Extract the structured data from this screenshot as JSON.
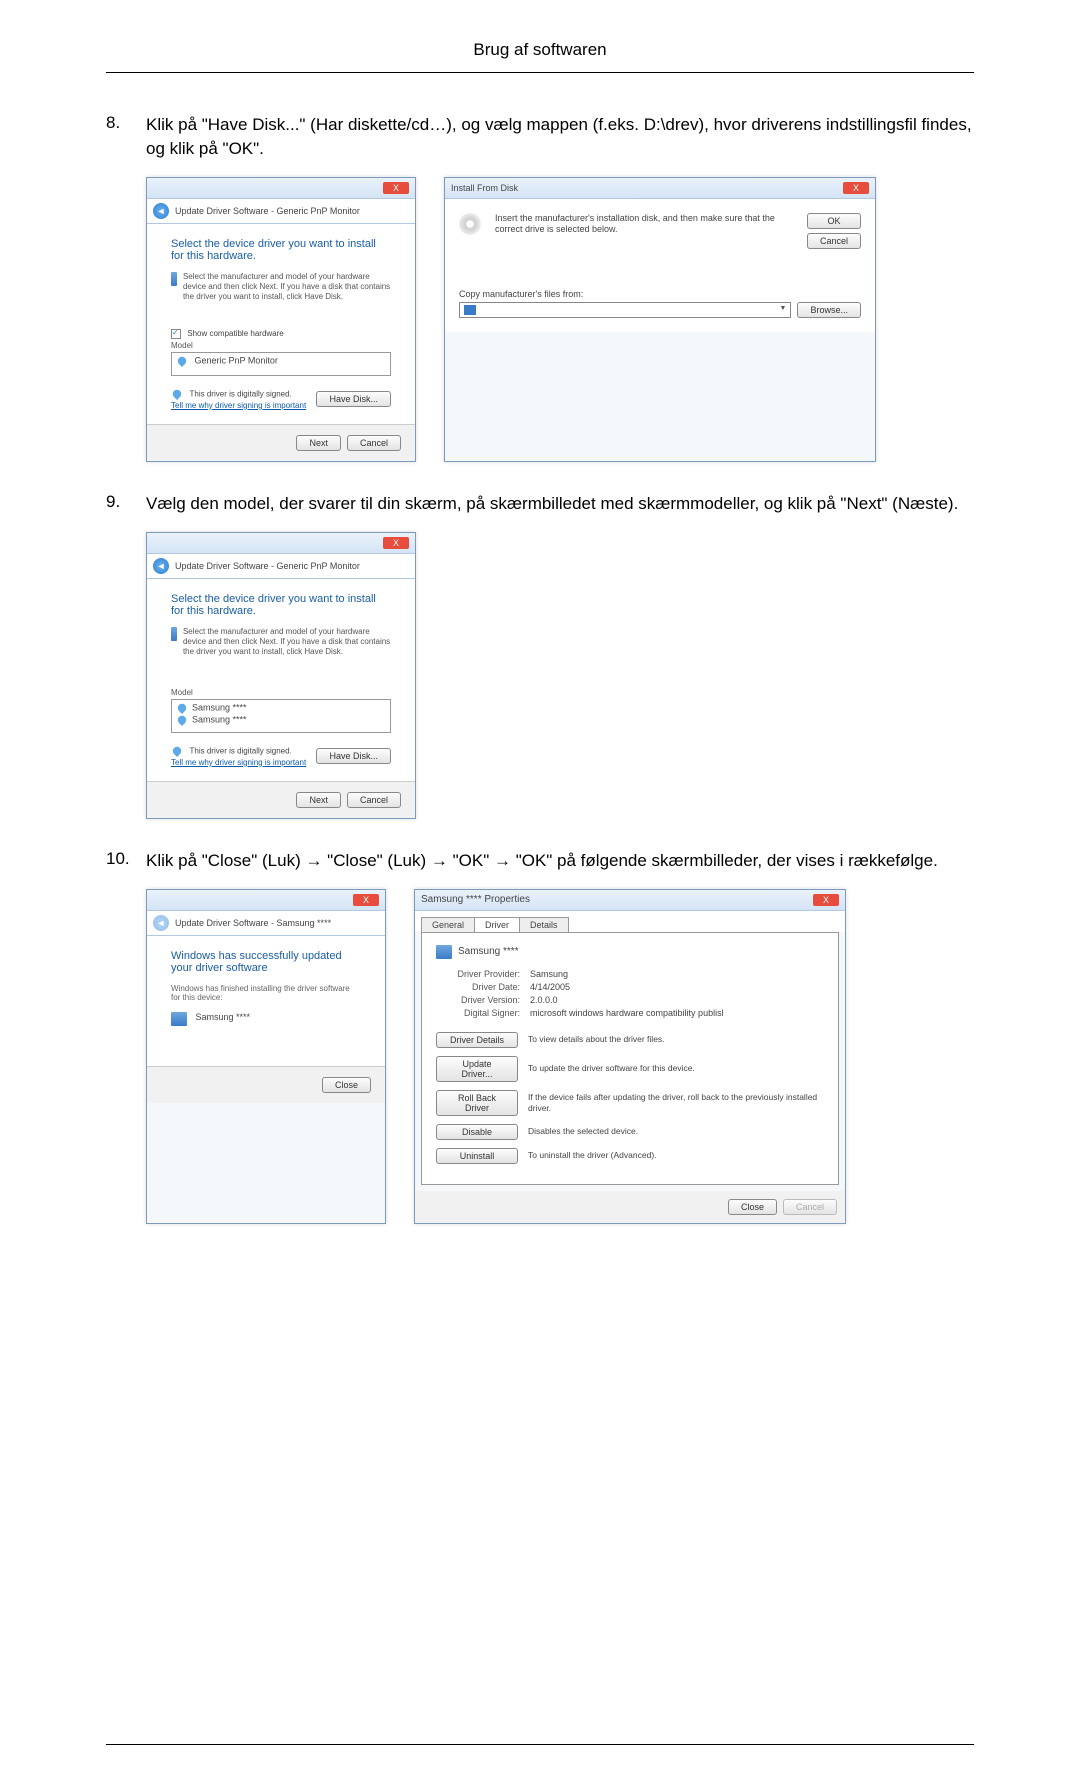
{
  "page": {
    "header": "Brug af softwaren"
  },
  "steps": [
    {
      "num": 8,
      "text": "Klik på \"Have Disk...\" (Har diskette/cd…), og vælg mappen (f.eks. D:\\drev), hvor driverens indstillingsfil findes, og klik på \"OK\"."
    },
    {
      "num": 9,
      "text": "Vælg den model, der svarer til din skærm, på skærmbilledet med skærmmodeller, og klik på \"Next\" (Næste)."
    },
    {
      "num": 10,
      "text": "Klik på \"Close\" (Luk) → \"Close\" (Luk) → \"OK\" → \"OK\" på følgende skærmbilleder, der vises i rækkefølge."
    }
  ],
  "wizard1": {
    "breadcrumb": "Update Driver Software - Generic PnP Monitor",
    "heading": "Select the device driver you want to install for this hardware.",
    "instruct": "Select the manufacturer and model of your hardware device and then click Next. If you have a disk that contains the driver you want to install, click Have Disk.",
    "chk": "Show compatible hardware",
    "model_label": "Model",
    "model_item": "Generic PnP Monitor",
    "signed": "This driver is digitally signed.",
    "link": "Tell me why driver signing is important",
    "have_disk": "Have Disk...",
    "next": "Next",
    "cancel": "Cancel"
  },
  "ifd": {
    "title": "Install From Disk",
    "msg": "Insert the manufacturer's installation disk, and then make sure that the correct drive is selected below.",
    "ok": "OK",
    "cancel": "Cancel",
    "copy": "Copy manufacturer's files from:",
    "drive": "",
    "browse": "Browse..."
  },
  "wizard2": {
    "breadcrumb": "Update Driver Software - Generic PnP Monitor",
    "heading": "Select the device driver you want to install for this hardware.",
    "instruct": "Select the manufacturer and model of your hardware device and then click Next. If you have a disk that contains the driver you want to install, click Have Disk.",
    "model_label": "Model",
    "model_item1": "Samsung ****",
    "model_item2": "Samsung ****",
    "signed": "This driver is digitally signed.",
    "link": "Tell me why driver signing is important",
    "have_disk": "Have Disk...",
    "next": "Next",
    "cancel": "Cancel"
  },
  "wizard3": {
    "breadcrumb": "Update Driver Software - Samsung ****",
    "heading": "Windows has successfully updated your driver software",
    "sub": "Windows has finished installing the driver software for this device:",
    "device": "Samsung ****",
    "close": "Close"
  },
  "props": {
    "title": "Samsung **** Properties",
    "tab_general": "General",
    "tab_driver": "Driver",
    "tab_details": "Details",
    "device": "Samsung ****",
    "labels": {
      "provider": "Driver Provider:",
      "date": "Driver Date:",
      "version": "Driver Version:",
      "signer": "Digital Signer:"
    },
    "values": {
      "provider": "Samsung",
      "date": "4/14/2005",
      "version": "2.0.0.0",
      "signer": "microsoft windows hardware compatibility publisl"
    },
    "buttons": {
      "details": "Driver Details",
      "details_desc": "To view details about the driver files.",
      "update": "Update Driver...",
      "update_desc": "To update the driver software for this device.",
      "rollback": "Roll Back Driver",
      "rollback_desc": "If the device fails after updating the driver, roll back to the previously installed driver.",
      "disable": "Disable",
      "disable_desc": "Disables the selected device.",
      "uninstall": "Uninstall",
      "uninstall_desc": "To uninstall the driver (Advanced)."
    },
    "close": "Close",
    "cancel": "Cancel"
  }
}
